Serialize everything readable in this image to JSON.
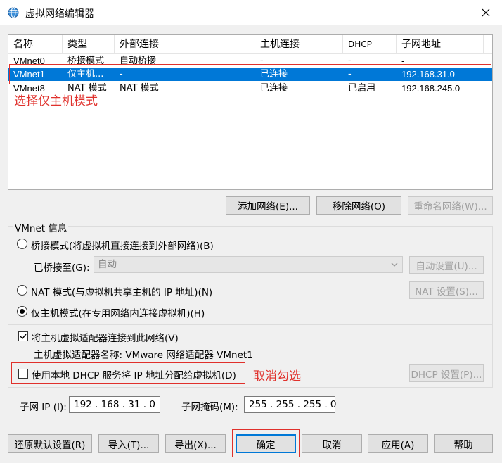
{
  "window": {
    "title": "虚拟网络编辑器"
  },
  "table": {
    "columns": [
      "名称",
      "类型",
      "外部连接",
      "主机连接",
      "DHCP",
      "子网地址"
    ],
    "rows": [
      {
        "name": "VMnet0",
        "type": "桥接模式",
        "external": "自动桥接",
        "host": "-",
        "dhcp": "-",
        "subnet": "-"
      },
      {
        "name": "VMnet1",
        "type": "仅主机...",
        "external": "-",
        "host": "已连接",
        "dhcp": "-",
        "subnet": "192.168.31.0"
      },
      {
        "name": "VMnet8",
        "type": "NAT 模式",
        "external": "NAT 模式",
        "host": "已连接",
        "dhcp": "已启用",
        "subnet": "192.168.245.0"
      }
    ],
    "selected_row": 1
  },
  "annotations": {
    "select_host_only": "选择仅主机模式",
    "uncheck": "取消勾选"
  },
  "network_buttons": {
    "add": "添加网络(E)...",
    "remove": "移除网络(O)",
    "rename": "重命名网络(W)..."
  },
  "vmnet_info": {
    "group_label": "VMnet 信息",
    "bridged_option": "桥接模式(将虚拟机直接连接到外部网络)(B)",
    "bridged_to_label": "已桥接至(G):",
    "bridged_to_value": "自动",
    "auto_settings": "自动设置(U)...",
    "nat_option": "NAT 模式(与虚拟机共享主机的 IP 地址)(N)",
    "nat_settings": "NAT 设置(S)...",
    "host_only_option": "仅主机模式(在专用网络内连接虚拟机)(H)",
    "connect_adapter": "将主机虚拟适配器连接到此网络(V)",
    "adapter_name": "主机虚拟适配器名称: VMware 网络适配器 VMnet1",
    "dhcp_option": "使用本地 DHCP 服务将 IP 地址分配给虚拟机(D)",
    "dhcp_settings": "DHCP 设置(P)...",
    "subnet_ip_label": "子网 IP (I):",
    "subnet_ip_value": "192 . 168 . 31 . 0",
    "subnet_mask_label": "子网掩码(M):",
    "subnet_mask_value": "255 . 255 . 255 . 0"
  },
  "bottom_buttons": {
    "restore": "还原默认设置(R)",
    "import": "导入(T)...",
    "export": "导出(X)...",
    "ok": "确定",
    "cancel": "取消",
    "apply": "应用(A)",
    "help": "帮助"
  },
  "colors": {
    "accent": "#0078d7",
    "annotation": "#e0302b"
  }
}
